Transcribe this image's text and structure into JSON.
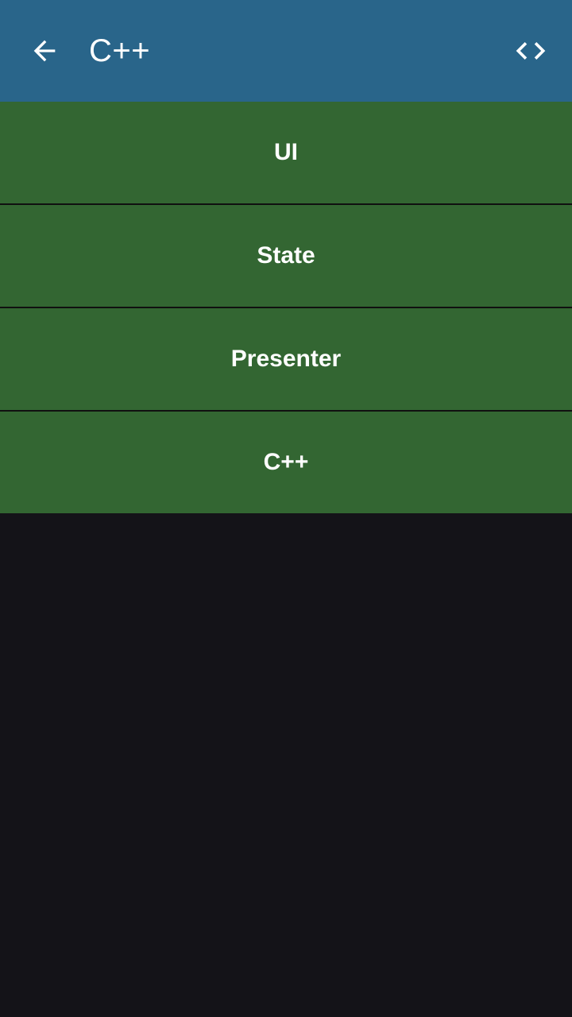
{
  "app_bar": {
    "title": "C++",
    "back_icon": "arrow-back-icon",
    "code_icon": "code-brackets-icon",
    "background": "#29658a"
  },
  "list": {
    "background": "#336632",
    "items": [
      {
        "label": "UI"
      },
      {
        "label": "State"
      },
      {
        "label": "Presenter"
      },
      {
        "label": "C++"
      }
    ]
  },
  "colors": {
    "page_background": "#141318",
    "text": "#ffffff",
    "divider": "#101010"
  }
}
